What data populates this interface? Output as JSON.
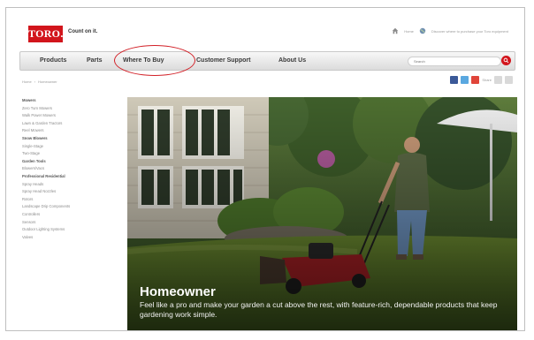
{
  "header": {
    "logo_text": "TORO.",
    "tagline": "Count on it.",
    "util_home": "Home",
    "util_link": "Discover where to purchase your Toro equipment"
  },
  "nav": {
    "items": [
      "Products",
      "Parts",
      "Where To Buy",
      "Customer Support",
      "About Us"
    ],
    "search_placeholder": "Search"
  },
  "breadcrumb": [
    "Home",
    "Homeowner"
  ],
  "share": {
    "label": "Share"
  },
  "sidebar": {
    "items": [
      {
        "label": "Mowers",
        "head": true
      },
      {
        "label": "Zero Turn Mowers",
        "head": false
      },
      {
        "label": "Walk Power Mowers",
        "head": false
      },
      {
        "label": "Lawn & Garden Tractors",
        "head": false
      },
      {
        "label": "Reel Mowers",
        "head": false
      },
      {
        "label": "Snow Blowers",
        "head": true
      },
      {
        "label": "Single-Stage",
        "head": false
      },
      {
        "label": "Two-Stage",
        "head": false
      },
      {
        "label": "Garden Tools",
        "head": true
      },
      {
        "label": "Blowers/Vacs",
        "head": false
      },
      {
        "label": "Professional Residential",
        "head": true
      },
      {
        "label": "Spray Heads",
        "head": false
      },
      {
        "label": "Spray Head Nozzles",
        "head": false
      },
      {
        "label": "Rotors",
        "head": false
      },
      {
        "label": "Landscape Drip Components",
        "head": false
      },
      {
        "label": "Controllers",
        "head": false
      },
      {
        "label": "Sensors",
        "head": false
      },
      {
        "label": "Outdoor Lighting Systems",
        "head": false
      },
      {
        "label": "Valves",
        "head": false
      }
    ]
  },
  "hero": {
    "title": "Homeowner",
    "text": "Feel like a pro and make your garden a cut above the rest, with feature-rich, dependable products that keep gardening work simple."
  },
  "colors": {
    "brand_red": "#d2151c",
    "nav_text": "#3a3a3a",
    "highlight": "#d22027"
  }
}
